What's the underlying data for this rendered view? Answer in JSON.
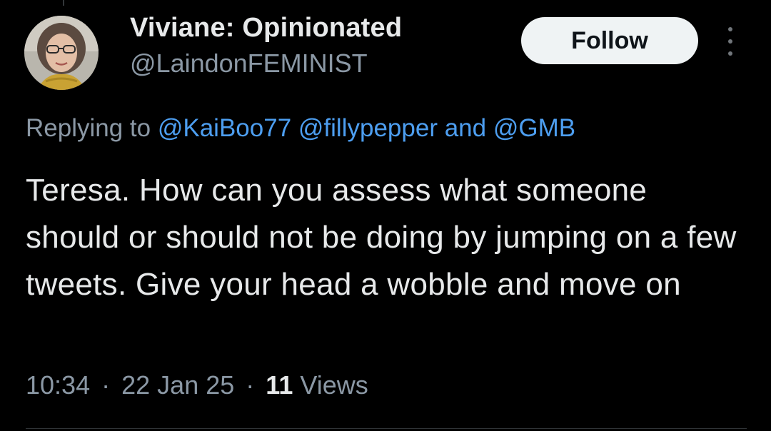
{
  "author": {
    "display_name": "Viviane: Opinionated",
    "handle": "@LaindonFEMINIST"
  },
  "follow_label": "Follow",
  "more_icon": "more-vertical-icon",
  "reply_context": {
    "prefix": "Replying to",
    "mention_1": "@KaiBoo77",
    "mention_2": "@fillypepper",
    "conjunction": "and",
    "mention_3": "@GMB"
  },
  "tweet_text": "Teresa. How can you assess what someone should or should not be doing by jumping on a few tweets. Give your head a wobble and move on",
  "meta": {
    "time": "10:34",
    "separator": "·",
    "date": "22 Jan 25",
    "views_count": "11",
    "views_label": "Views"
  },
  "colors": {
    "background": "#000000",
    "text_primary": "#e7e9ea",
    "text_secondary": "#8b98a5",
    "link": "#4d9ef0",
    "follow_bg": "#eff3f4"
  }
}
